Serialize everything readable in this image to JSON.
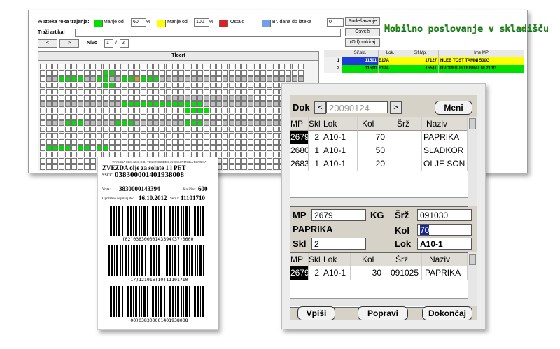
{
  "desktop": {
    "expiry_label": "% Izteka roka trajanja:",
    "legend": [
      {
        "label": "Manje od",
        "value": "60",
        "unit": "%",
        "color": "#00e000"
      },
      {
        "label": "Manje od",
        "value": "100",
        "unit": "%",
        "color": "#ffff00"
      },
      {
        "label": "Ostalo",
        "value": "",
        "unit": "",
        "color": "#e02020"
      },
      {
        "label": "Br. dana do izteka",
        "value": "0",
        "unit": "",
        "color": "#6fa0e8"
      }
    ],
    "search_label": "Traži artikal",
    "search_value": "",
    "level_label": "Nivo",
    "level_current": "1",
    "level_sep": "/",
    "level_total": "2",
    "buttons": {
      "settings": "Podešavanje",
      "refresh": "Osveži",
      "unblock": "(Od)blokiraj",
      "prev": "<",
      "next": ">"
    },
    "app_title": "Mobilno poslovanje v skladišču",
    "layout_title": "Tlocrt",
    "mp_table": {
      "headers": [
        "",
        "Šif.skl.",
        "Lok.",
        "Šif.Mp.",
        "Ime MP"
      ],
      "rows": [
        {
          "n": "1",
          "skl": "11501",
          "lok": "E17A",
          "mp": "17127",
          "name": "HLEB TOST TAMNI 500G"
        },
        {
          "n": "2",
          "skl": "11500",
          "lok": "E17A",
          "mp": "15511",
          "name": "DVOPEK INTEGRALNI 210G"
        }
      ]
    }
  },
  "label": {
    "company": "TOVARNA OLJA GEA, D.D., TRG SVOBODE 3, 2310 SLOVENSKA BISTRICA",
    "product": "ZVEZDA olje za solate 1 l PET",
    "sscc_label": "SSCC:",
    "sscc": "038300001401938008",
    "vrsta_label": "Vrsta:",
    "vrsta": "3830000143394",
    "kolicina_label": "Količina:",
    "kolicina": "600",
    "upotreba_label": "Uporabno najmanj do:",
    "upotreba": "16.10.2012",
    "serija_label": "Serija:",
    "serija": "11101710",
    "barcode1_text": "(02)03830000143394(37)0600",
    "barcode2_text": "(17)121016(10)11101710",
    "barcode3_text": "(00)038300001401938008"
  },
  "mobile": {
    "dok_label": "Dok",
    "dok_value": "20090124",
    "menu_button": "Meni",
    "table_headers": [
      "MP",
      "Skl",
      "Lok",
      "Kol",
      "Šrž",
      "Naziv"
    ],
    "rows": [
      {
        "mp": "2679",
        "skl": "2",
        "lok": "A10-1",
        "kol": "70",
        "srz": "",
        "naziv": "PAPRIKA"
      },
      {
        "mp": "2680",
        "skl": "1",
        "lok": "A10-1",
        "kol": "50",
        "srz": "",
        "naziv": "SLADKOR"
      },
      {
        "mp": "2683",
        "skl": "1",
        "lok": "A10-1",
        "kol": "20",
        "srz": "",
        "naziv": "OLJE SON"
      }
    ],
    "mp_label": "MP",
    "mp_value": "2679",
    "kg_label": "KG",
    "srz_label": "Šrž",
    "srz_value": "091030",
    "item_name": "PAPRIKA",
    "kol_label": "Kol",
    "kol_value": "70",
    "skl_label": "Skl",
    "skl_value": "2",
    "lok_label": "Lok",
    "lok_value": "A10-1",
    "table2_headers": [
      "MP",
      "Skl",
      "Lok",
      "Kol",
      "Šrž",
      "Naziv"
    ],
    "rows2": [
      {
        "mp": "2679",
        "skl": "2",
        "lok": "A10-1",
        "kol": "30",
        "srz": "091025",
        "naziv": "PAPRIKA"
      }
    ],
    "buttons": {
      "write": "Vpiši",
      "fix": "Popravi",
      "finish": "Dokončaj"
    }
  }
}
